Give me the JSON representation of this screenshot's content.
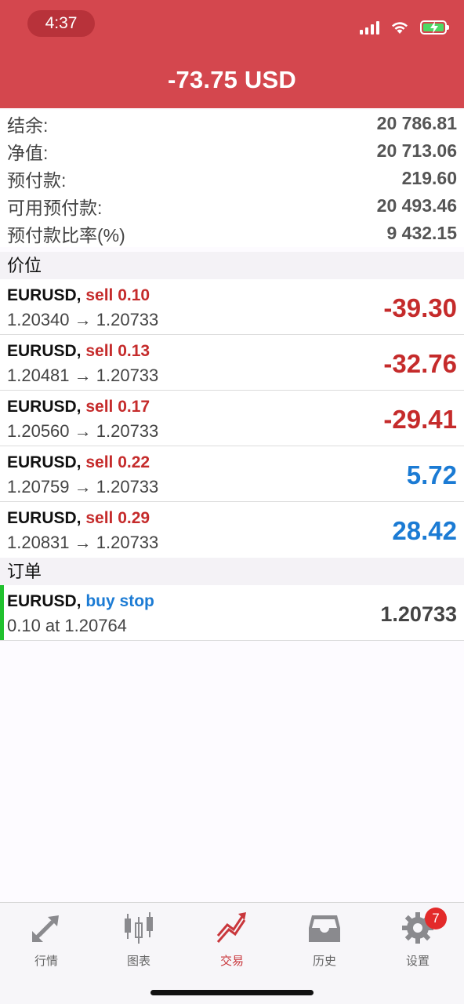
{
  "status_bar": {
    "time": "4:37"
  },
  "header": {
    "title": "-73.75 USD",
    "background_color": "#d4474e"
  },
  "summary": [
    {
      "label": "结余:",
      "value": "20 786.81"
    },
    {
      "label": "净值:",
      "value": "20 713.06"
    },
    {
      "label": "预付款:",
      "value": "219.60"
    },
    {
      "label": "可用预付款:",
      "value": "20 493.46"
    },
    {
      "label": "预付款比率(%)",
      "value": "9 432.15"
    }
  ],
  "positions_section": {
    "title": "价位"
  },
  "positions": [
    {
      "symbol": "EURUSD,",
      "side": "sell 0.10",
      "prices": "1.20340 → 1.20733",
      "profit": "-39.30"
    },
    {
      "symbol": "EURUSD,",
      "side": "sell 0.13",
      "prices": "1.20481 → 1.20733",
      "profit": "-32.76"
    },
    {
      "symbol": "EURUSD,",
      "side": "sell 0.17",
      "prices": "1.20560 → 1.20733",
      "profit": "-29.41"
    },
    {
      "symbol": "EURUSD,",
      "side": "sell 0.22",
      "prices": "1.20759 → 1.20733",
      "profit": "5.72"
    },
    {
      "symbol": "EURUSD,",
      "side": "sell 0.29",
      "prices": "1.20831 → 1.20733",
      "profit": "28.42"
    }
  ],
  "orders_section": {
    "title": "订单"
  },
  "orders": [
    {
      "symbol": "EURUSD,",
      "side": "buy stop",
      "details": "0.10 at 1.20764",
      "price": "1.20733"
    }
  ],
  "tabbar": {
    "tabs": [
      {
        "label": "行情",
        "icon": "quotes-arrows-icon"
      },
      {
        "label": "图表",
        "icon": "candlestick-chart-icon"
      },
      {
        "label": "交易",
        "icon": "trade-trend-icon",
        "active": true
      },
      {
        "label": "历史",
        "icon": "history-tray-icon"
      },
      {
        "label": "设置",
        "icon": "settings-gear-icon",
        "badge": "7"
      }
    ]
  },
  "colors": {
    "negative": "#c52b2b",
    "positive": "#1b7bd4",
    "active_tab": "#c9373c",
    "order_bar": "#20c12e"
  }
}
